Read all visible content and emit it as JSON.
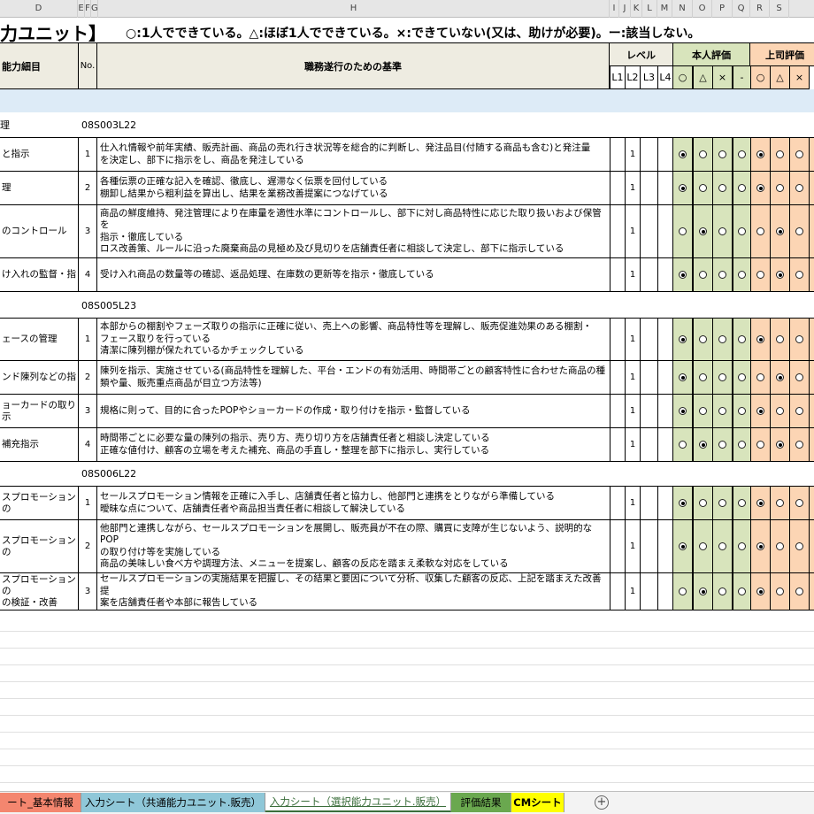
{
  "columns": [
    "D",
    "E",
    "F",
    "G",
    "H",
    "I",
    "J",
    "K",
    "L",
    "M",
    "N",
    "O",
    "P",
    "Q",
    "R",
    "S"
  ],
  "title": {
    "left": "力ユニット】",
    "legend": "○:1人でできている。△:ほぼ1人でできている。×:できていない(又は、助けが必要)。ー:該当しない。"
  },
  "header": {
    "skill_label": "能力細目",
    "no_label": "No.",
    "criteria_label": "職務遂行のための基準",
    "level_label": "レベル",
    "self_eval_label": "本人評価",
    "boss_eval_label": "上司評価",
    "levels": [
      "L1",
      "L2",
      "L3",
      "L4"
    ],
    "self_marks": [
      "○",
      "△",
      "×",
      "-"
    ],
    "boss_marks": [
      "○",
      "△",
      "×"
    ]
  },
  "groups": [
    {
      "name": "理",
      "code": "08S003L22",
      "rows": [
        {
          "skill": "と指示",
          "no": "1",
          "text": "仕入れ情報や前年実績、販売計画、商品の売れ行き状況等を総合的に判断し、発注品目(付随する商品も含む)と発注量\nを決定し、部下に指示をし、商品を発注している",
          "level": "1",
          "self": 0,
          "boss": 0
        },
        {
          "skill": "理",
          "no": "2",
          "text": "各種伝票の正確な記入を確認、徹底し、遅滞なく伝票を回付している\n棚卸し結果から粗利益を算出し、結果を業務改善提案につなげている",
          "level": "1",
          "self": 0,
          "boss": 0
        },
        {
          "skill": "のコントロール",
          "no": "3",
          "text": "商品の鮮度維持、発注管理により在庫量を適性水準にコントロールし、部下に対し商品特性に応じた取り扱いおよび保管を\n指示・徹底している\nロス改善策、ルールに沿った廃棄商品の見極め及び見切りを店舗責任者に相談して決定し、部下に指示している",
          "level": "1",
          "self": 1,
          "boss": 1
        },
        {
          "skill": "け入れの監督・指",
          "no": "4",
          "text": "受け入れ商品の数量等の確認、返品処理、在庫数の更新等を指示・徹底している",
          "level": "1",
          "self": 0,
          "boss": 1
        }
      ]
    },
    {
      "name": "",
      "code": "08S005L23",
      "rows": [
        {
          "skill": "ェースの管理",
          "no": "1",
          "text": "本部からの棚割やフェーズ取りの指示に正確に従い、売上への影響、商品特性等を理解し、販売促進効果のある棚割・\nフェース取りを行っている\n清潔に陳列棚が保たれているかチェックしている",
          "level": "1",
          "self": 0,
          "boss": 0
        },
        {
          "skill": "ンド陳列などの指",
          "no": "2",
          "text": "陳列を指示、実施させている(商品特性を理解した、平台・エンドの有効活用、時間帯ごとの顧客特性に合わせた商品の種\n類や量、販売重点商品が目立つ方法等)",
          "level": "1",
          "self": 0,
          "boss": 1
        },
        {
          "skill": "ョーカードの取り\n示",
          "no": "3",
          "text": "規格に則って、目的に合ったPOPやショーカードの作成・取り付けを指示・監督している",
          "level": "1",
          "self": 0,
          "boss": 0
        },
        {
          "skill": "補充指示",
          "no": "4",
          "text": "時間帯ごとに必要な量の陳列の指示、売り方、売り切り方を店舗責任者と相談し決定している\n正確な値付け、顧客の立場を考えた補充、商品の手直し・整理を部下に指示し、実行している",
          "level": "1",
          "self": 1,
          "boss": 1
        }
      ]
    },
    {
      "name": "",
      "code": "08S006L22",
      "rows": [
        {
          "skill": "スプロモーションの",
          "no": "1",
          "text": "セールスプロモーション情報を正確に入手し、店舗責任者と協力し、他部門と連携をとりながら準備している\n曖昧な点について、店舗責任者や商品担当責任者に相談して解決している",
          "level": "1",
          "self": 0,
          "boss": 0
        },
        {
          "skill": "スプロモーションの",
          "no": "2",
          "text": "他部門と連携しながら、セールスプロモーションを展開し、販売員が不在の際、購買に支障が生じないよう、説明的なPOP\nの取り付け等を実施している\n商品の美味しい食べ方や調理方法、メニューを提案し、顧客の反応を踏まえ柔軟な対応をしている",
          "level": "1",
          "self": 0,
          "boss": 0
        },
        {
          "skill": "スプロモーションの\nの検証・改善",
          "no": "3",
          "text": "セールスプロモーションの実施結果を把握し、その結果と要因について分析、収集した顧客の反応、上記を踏まえた改善提\n案を店舗責任者や本部に報告している",
          "level": "1",
          "self": 1,
          "boss": 0
        }
      ]
    }
  ],
  "tabs": [
    {
      "label": "ート_基本情報",
      "bg": "#f4866f",
      "color": "#000000"
    },
    {
      "label": "入力シート（共通能力ユニット.販売）",
      "bg": "#8fc7d8",
      "color": "#000000"
    },
    {
      "label": "入力シート（選択能力ユニット.販売）",
      "bg": "#ffffff",
      "color": "#3b6e3b"
    },
    {
      "label": "評価結果",
      "bg": "#6aa84f",
      "color": "#000000"
    },
    {
      "label": "CMシート",
      "bg": "#ffff00",
      "color": "#000000"
    }
  ],
  "add_sheet_label": "+"
}
